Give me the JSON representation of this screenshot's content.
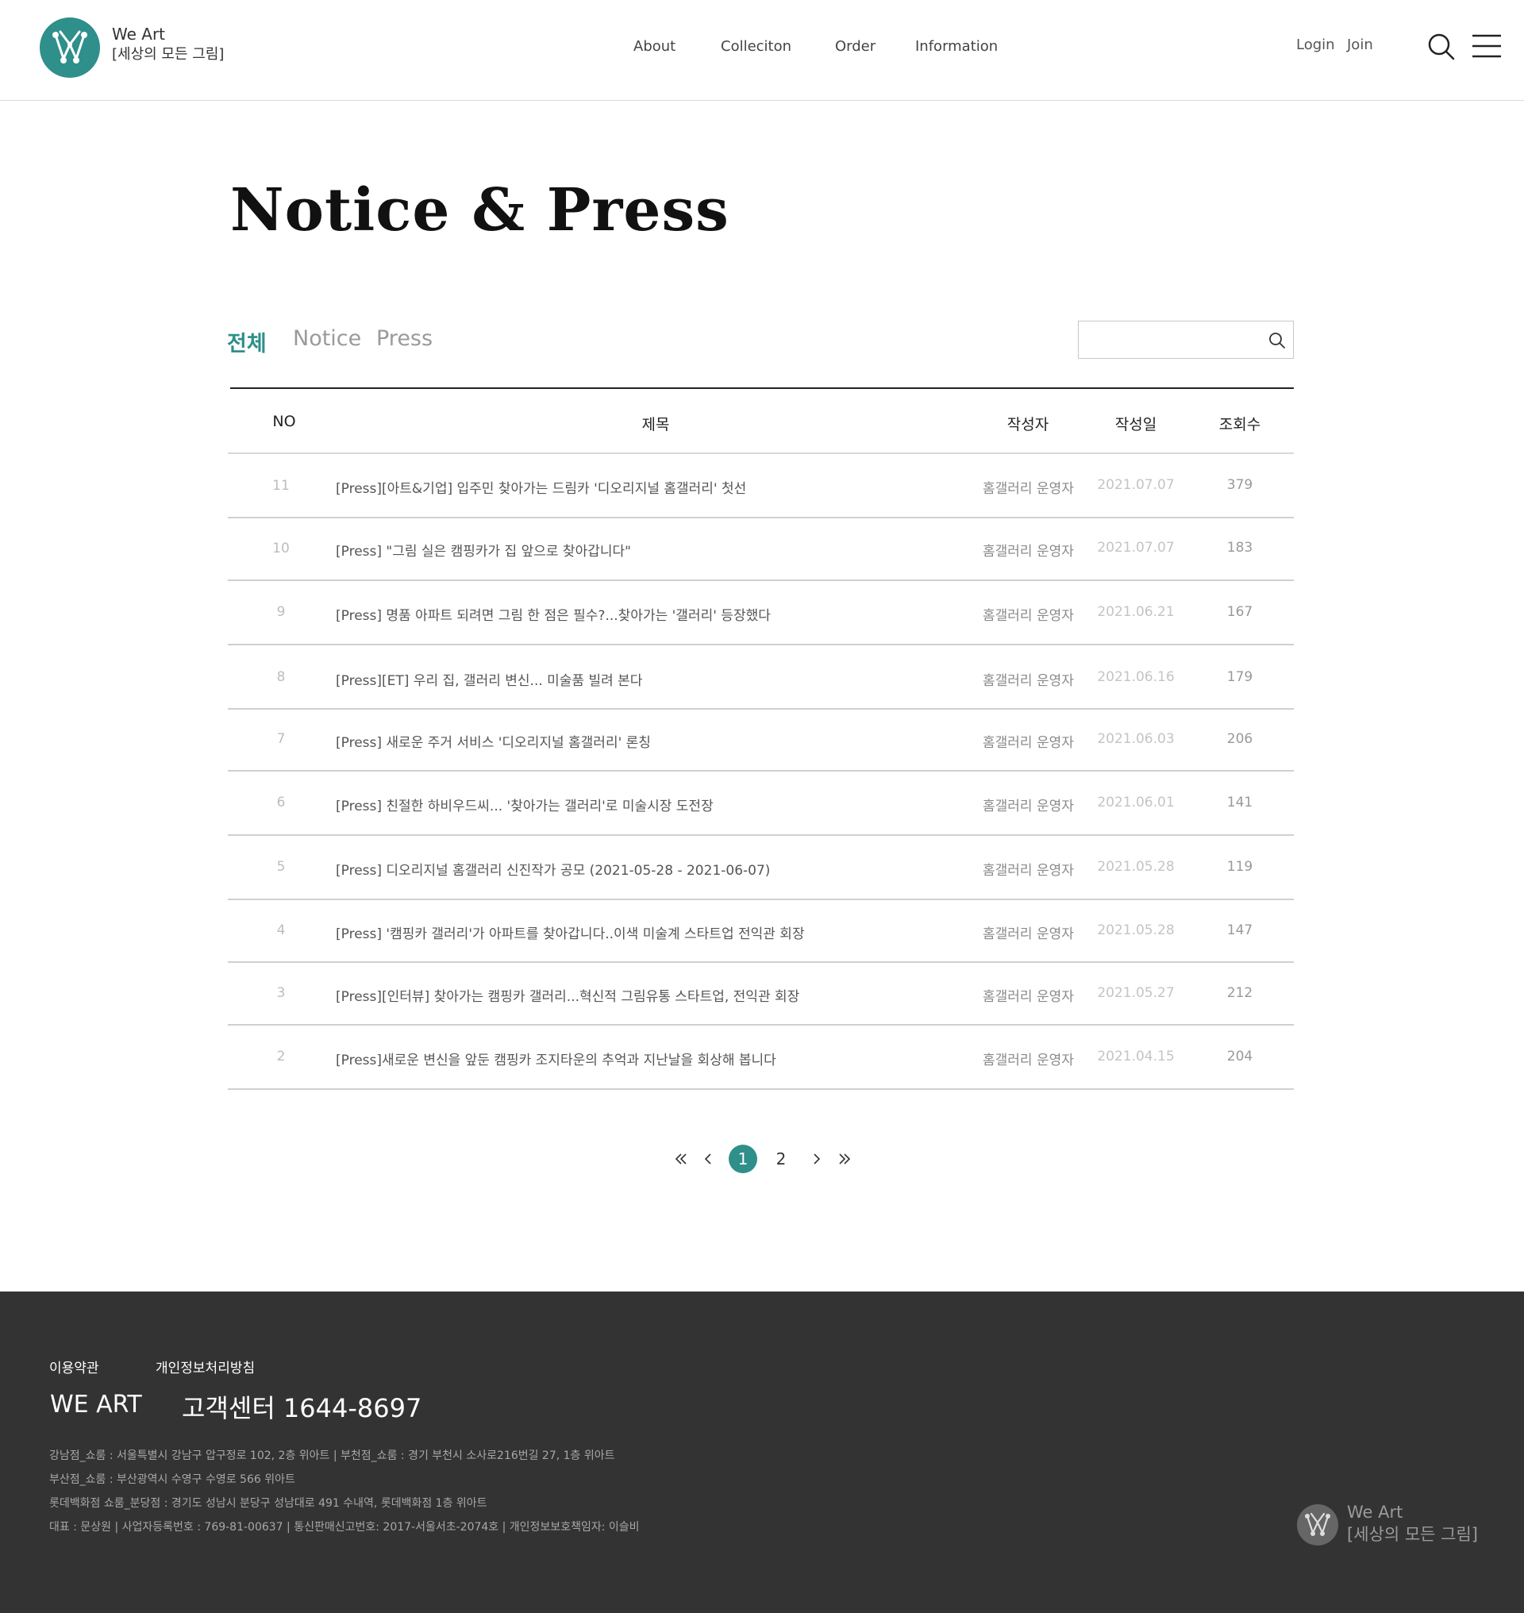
{
  "header": {
    "brand_name": "We Art",
    "brand_sub": "[세상의 모든 그림]",
    "nav": [
      "About",
      "Colleciton",
      "Order",
      "Information"
    ],
    "login": "Login",
    "join": "Join"
  },
  "page_title": "Notice & Press",
  "tabs": [
    "전체",
    "Notice",
    "Press"
  ],
  "search": {
    "placeholder": ""
  },
  "table": {
    "headers": [
      "NO",
      "제목",
      "작성자",
      "작성일",
      "조회수"
    ],
    "rows": [
      {
        "no": "11",
        "title": "[Press][아트&기업] 입주민 찾아가는 드림카 '디오리지널 홈갤러리' 첫선",
        "writer": "홈갤러리 운영자",
        "date": "2021.07.07",
        "views": "379"
      },
      {
        "no": "10",
        "title": "[Press] \"그림 실은 캠핑카가 집 앞으로 찾아갑니다\"",
        "writer": "홈갤러리 운영자",
        "date": "2021.07.07",
        "views": "183"
      },
      {
        "no": "9",
        "title": "[Press] 명품 아파트 되려면 그림 한 점은 필수?...찾아가는 '갤러리' 등장했다",
        "writer": "홈갤러리 운영자",
        "date": "2021.06.21",
        "views": "167"
      },
      {
        "no": "8",
        "title": "[Press][ET] 우리 집, 갤러리 변신... 미술품 빌려 본다",
        "writer": "홈갤러리 운영자",
        "date": "2021.06.16",
        "views": "179"
      },
      {
        "no": "7",
        "title": "[Press] 새로운 주거 서비스 '디오리지널 홈갤러리' 론칭",
        "writer": "홈갤러리 운영자",
        "date": "2021.06.03",
        "views": "206"
      },
      {
        "no": "6",
        "title": "[Press] 친절한 하비우드씨... '찾아가는 갤러리'로 미술시장 도전장",
        "writer": "홈갤러리 운영자",
        "date": "2021.06.01",
        "views": "141"
      },
      {
        "no": "5",
        "title": "[Press] 디오리지널 홈갤러리 신진작가 공모 (2021-05-28 - 2021-06-07)",
        "writer": "홈갤러리 운영자",
        "date": "2021.05.28",
        "views": "119"
      },
      {
        "no": "4",
        "title": "[Press] '캠핑카 갤러리'가 아파트를 찾아갑니다..이색 미술계 스타트업 전익관 회장",
        "writer": "홈갤러리 운영자",
        "date": "2021.05.28",
        "views": "147"
      },
      {
        "no": "3",
        "title": "[Press][인터뷰] 찾아가는 캠핑카 갤러리...혁신적 그림유통 스타트업, 전익관 회장",
        "writer": "홈갤러리 운영자",
        "date": "2021.05.27",
        "views": "212"
      },
      {
        "no": "2",
        "title": "[Press]새로운 변신을 앞둔 캠핑카 조지타운의 추억과 지난날을 회상해 봅니다",
        "writer": "홈갤러리 운영자",
        "date": "2021.04.15",
        "views": "204"
      }
    ]
  },
  "pagination": {
    "pages": [
      "1",
      "2"
    ],
    "current": "1"
  },
  "footer": {
    "links": [
      "이용약관",
      "개인정보처리방침"
    ],
    "brand": "WE ART",
    "customer_center": "고객센터 1644-8697",
    "info_lines": [
      "강남점_쇼룸 : 서울특별시 강남구 압구정로 102, 2층 위아트 | 부천점_쇼룸 : 경기 부천시 소사로216번길 27, 1층 위아트",
      "부산점_쇼룸 : 부산광역시 수영구 수영로 566 위아트",
      "롯데백화점 쇼룸_분당점 : 경기도 성남시 분당구 성남대로 491 수내역, 롯데백화점 1층 위아트",
      "대표 : 문상원 | 사업자등록번호 : 769-81-00637 | 통신판매신고번호: 2017-서울서초-2074호 | 개인정보보호책임자: 이슬비"
    ],
    "brand_name": "We Art",
    "brand_sub": "[세상의 모든 그림]"
  },
  "colors": {
    "accent": "#2f8f8a",
    "footer_bg": "#333333"
  }
}
